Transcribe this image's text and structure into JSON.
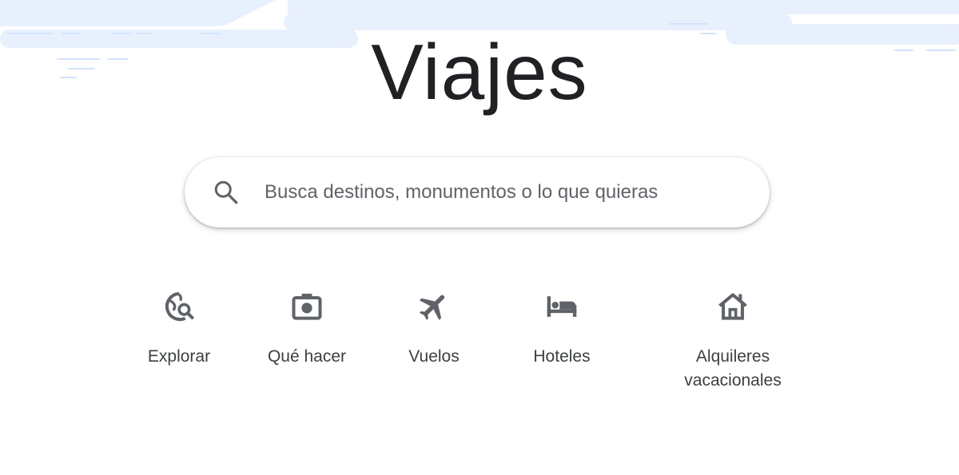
{
  "page": {
    "title": "Viajes"
  },
  "search": {
    "placeholder": "Busca destinos, monumentos o lo que quieras",
    "value": "",
    "icon": "search-icon"
  },
  "categories": [
    {
      "label": "Explorar",
      "icon": "explore-globe-icon"
    },
    {
      "label": "Qué hacer",
      "icon": "camera-icon"
    },
    {
      "label": "Vuelos",
      "icon": "airplane-icon"
    },
    {
      "label": "Hoteles",
      "icon": "bed-icon"
    },
    {
      "label": "Alquileres vacacionales",
      "icon": "house-icon"
    }
  ],
  "colors": {
    "title": "#202124",
    "label": "#3c4043",
    "icon": "#5f6368",
    "placeholder": "#5f6368",
    "decor": "#e8f0fe"
  }
}
